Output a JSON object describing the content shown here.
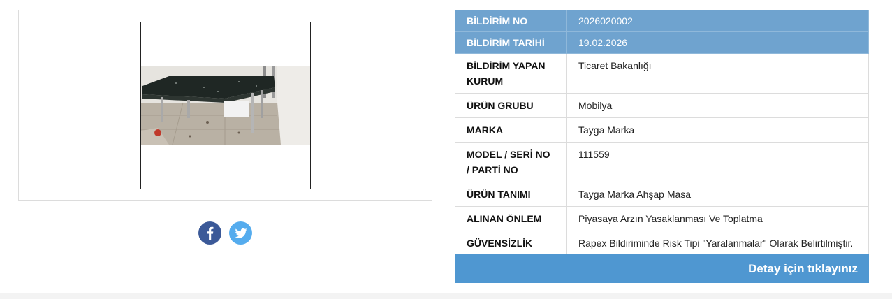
{
  "notification": {
    "rows": [
      {
        "label": "BİLDİRİM NO",
        "value": "2026020002"
      },
      {
        "label": "BİLDİRİM TARİHİ",
        "value": "19.02.2026"
      },
      {
        "label": "BİLDİRİM YAPAN KURUM",
        "value": "Ticaret Bakanlığı"
      },
      {
        "label": "ÜRÜN GRUBU",
        "value": "Mobilya"
      },
      {
        "label": "MARKA",
        "value": "Tayga Marka"
      },
      {
        "label": "MODEL / SERİ NO / PARTİ NO",
        "value": "111559"
      },
      {
        "label": "ÜRÜN TANIMI",
        "value": "Tayga Marka Ahşap Masa"
      },
      {
        "label": "ALINAN ÖNLEM",
        "value": "Piyasaya Arzın Yasaklanması Ve Toplatma"
      },
      {
        "label": "GÜVENSİZLİK NEDENİ",
        "value": "Rapex Bildiriminde Risk Tipi \"Yaralanmalar\" Olarak Belirtilmiştir."
      }
    ],
    "detail_button": "Detay için tıklayınız"
  },
  "share": {
    "facebook_icon": "facebook-icon",
    "twitter_icon": "twitter-icon"
  },
  "colors": {
    "header_row": "#6fa3cf",
    "detail_button": "#4f97d1",
    "facebook": "#3b5998",
    "twitter": "#55acee"
  }
}
